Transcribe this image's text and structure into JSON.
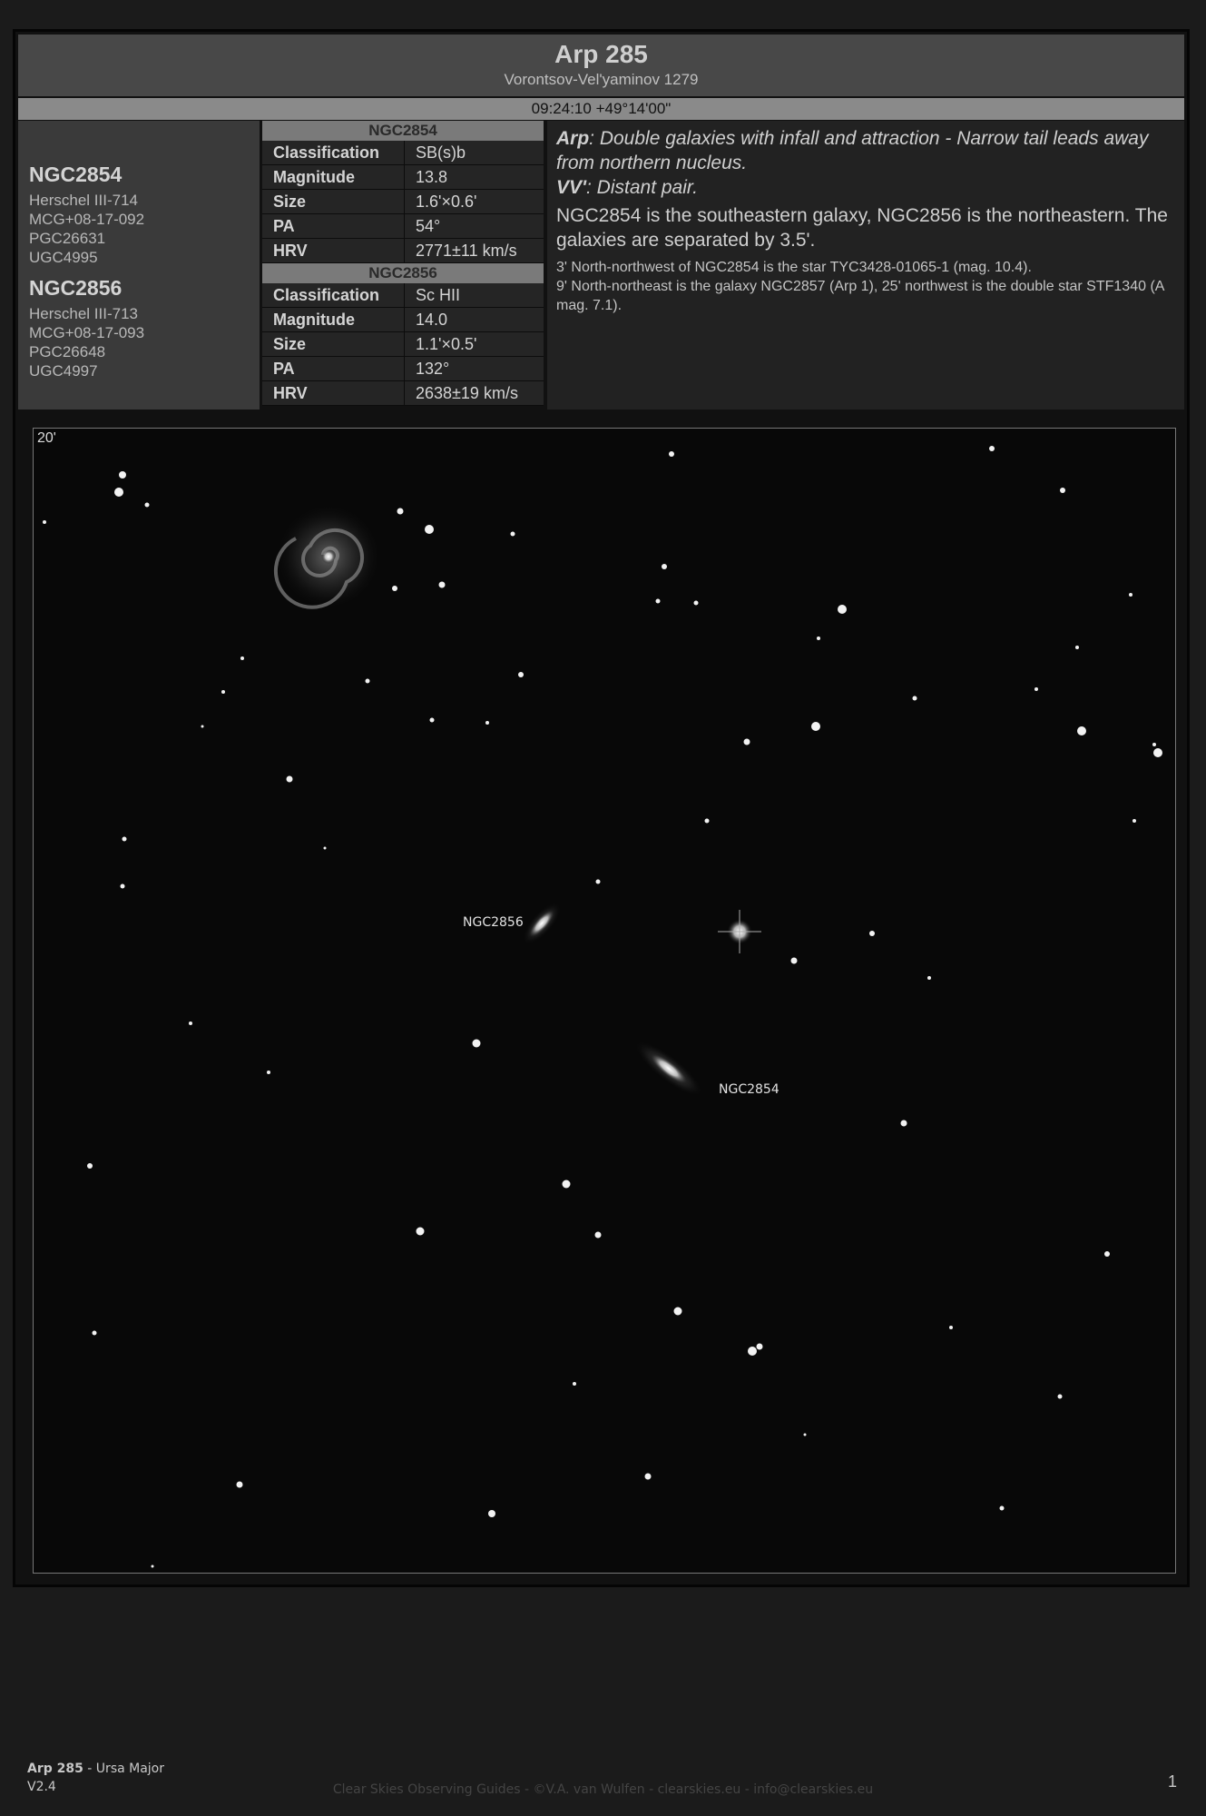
{
  "header": {
    "title": "Arp 285",
    "subtitle": "Vorontsov-Vel'yaminov 1279",
    "coordinates": "09:24:10 +49°14'00\""
  },
  "designations": [
    {
      "name": "NGC2854",
      "aliases": [
        "Herschel III-714",
        "MCG+08-17-092",
        "PGC26631",
        "UGC4995"
      ]
    },
    {
      "name": "NGC2856",
      "aliases": [
        "Herschel III-713",
        "MCG+08-17-093",
        "PGC26648",
        "UGC4997"
      ]
    }
  ],
  "properties": [
    {
      "name": "NGC2854",
      "rows": [
        {
          "key": "Classification",
          "value": "SB(s)b"
        },
        {
          "key": "Magnitude",
          "value": "13.8"
        },
        {
          "key": "Size",
          "value": "1.6'×0.6'"
        },
        {
          "key": "PA",
          "value": "54°"
        },
        {
          "key": "HRV",
          "value": "2771±11 km/s"
        }
      ]
    },
    {
      "name": "NGC2856",
      "rows": [
        {
          "key": "Classification",
          "value": "Sc HII"
        },
        {
          "key": "Magnitude",
          "value": "14.0"
        },
        {
          "key": "Size",
          "value": "1.1'×0.5'"
        },
        {
          "key": "PA",
          "value": "132°"
        },
        {
          "key": "HRV",
          "value": "2638±19 km/s"
        }
      ]
    }
  ],
  "description": {
    "arp_label": "Arp",
    "arp_text": ": Double galaxies with infall and attraction - Narrow tail leads away from northern nucleus.",
    "vv_label": "VV'",
    "vv_text": ": Distant pair.",
    "main": "NGC2854 is the southeastern galaxy, NGC2856 is the northeastern. The galaxies are separated by 3.5'.",
    "note1": "3' North-northwest of NGC2854 is the star TYC3428-01065-1 (mag. 10.4).",
    "note2": "9' North-northeast is the galaxy NGC2857 (Arp 1), 25' northwest is the double star STF1340 (A mag. 7.1)."
  },
  "image": {
    "fov_label": "20'",
    "labels": {
      "ngc2856": "NGC2856",
      "ngc2854": "NGC2854"
    }
  },
  "footer": {
    "object": "Arp 285",
    "constellation": " - Ursa Major",
    "version": "V2.4",
    "credit": "Clear Skies Observing Guides - ©V.A. van Wulfen - clearskies.eu - info@clearskies.eu",
    "page": "1"
  }
}
